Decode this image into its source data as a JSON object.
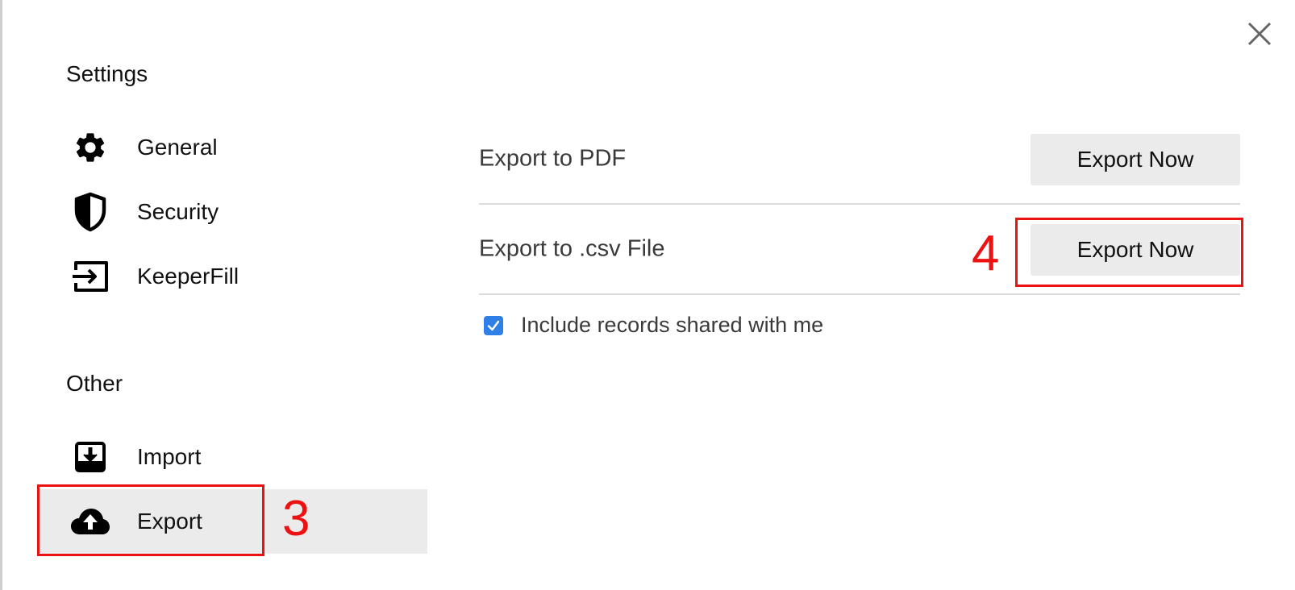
{
  "settings": {
    "section_title": "Settings",
    "items": [
      {
        "label": "General",
        "icon": "gear-icon"
      },
      {
        "label": "Security",
        "icon": "shield-icon"
      },
      {
        "label": "KeeperFill",
        "icon": "keeperfill-icon"
      }
    ]
  },
  "other": {
    "section_title": "Other",
    "items": [
      {
        "label": "Import",
        "icon": "import-icon"
      },
      {
        "label": "Export",
        "icon": "cloud-upload-icon",
        "selected": true
      }
    ]
  },
  "export_panel": {
    "rows": [
      {
        "label": "Export to PDF",
        "button_label": "Export Now"
      },
      {
        "label": "Export to .csv File",
        "button_label": "Export Now"
      }
    ],
    "include_shared": {
      "label": "Include records shared with me",
      "checked": true
    }
  },
  "annotations": {
    "export_nav_step": "3",
    "export_csv_step": "4",
    "color": "#ee1111"
  },
  "colors": {
    "checkbox": "#2f7fe6",
    "selected_bg": "#ebebeb",
    "button_bg": "#ebebeb"
  }
}
